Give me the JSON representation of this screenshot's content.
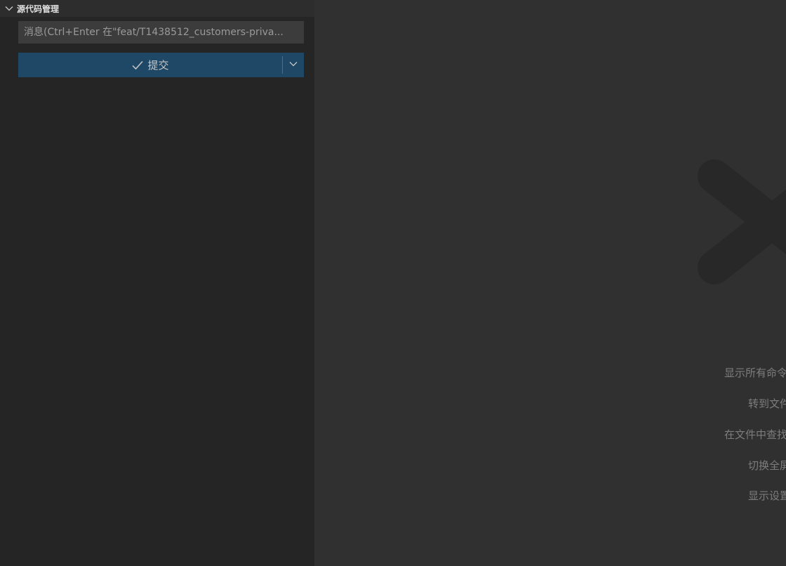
{
  "sidebar": {
    "section_title": "源代码管理",
    "commit_message_placeholder": "消息(Ctrl+Enter 在\"feat/T1438512_customers-priva...",
    "commit_button_label": "提交"
  },
  "editor": {
    "shortcuts": [
      {
        "label": "显示所有命令"
      },
      {
        "label": "转到文件"
      },
      {
        "label": "在文件中查找"
      },
      {
        "label": "切换全屏"
      },
      {
        "label": "显示设置"
      }
    ]
  }
}
